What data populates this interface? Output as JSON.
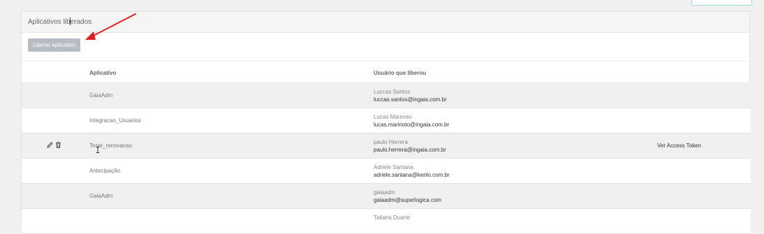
{
  "panel": {
    "title": "Aplicativos liberados",
    "release_button": "Liberar aplicativo"
  },
  "table": {
    "headers": {
      "app": "Aplicativo",
      "user": "Usuário que liberou"
    },
    "rows": [
      {
        "app": "GaiaAdm",
        "user_name": "Luccas Santos",
        "user_email": "luccas.santos@ingaia.com.br",
        "token": ""
      },
      {
        "app": "Integracao_Usuarios",
        "user_name": "Lucas Marinoto",
        "user_email": "lucas.marinoto@ingaia.com.br",
        "token": ""
      },
      {
        "app": "Teste_renovacao",
        "user_name": "paulo Herrera",
        "user_email": "paulo.herrera@ingaia.com.br",
        "token": "Ver Access Token"
      },
      {
        "app": "Antecipação",
        "user_name": "Adriele Santana",
        "user_email": "adriele.santana@kenlo.com.br",
        "token": ""
      },
      {
        "app": "GaiaAdm",
        "user_name": "gaiaadm",
        "user_email": "gaiaadm@superlogica.com",
        "token": ""
      },
      {
        "app": "",
        "user_name": "Tatiana Duarte",
        "user_email": "",
        "token": ""
      }
    ]
  },
  "icons": {
    "edit": "pencil-icon",
    "delete": "trash-icon"
  },
  "colors": {
    "annotation_arrow": "#e02020",
    "button_bg": "#b8bcc4",
    "row_stripe": "#f0f0f0"
  }
}
